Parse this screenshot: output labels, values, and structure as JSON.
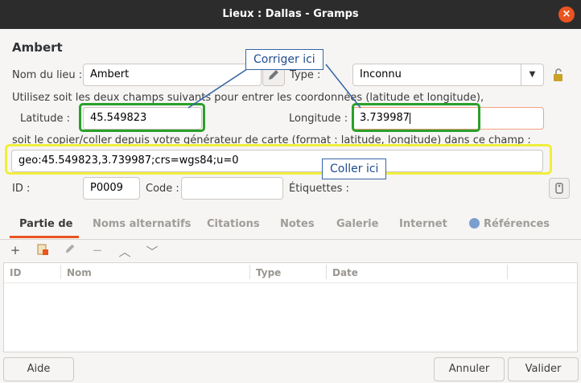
{
  "window": {
    "title": "Lieux : Dallas - Gramps",
    "close": "×"
  },
  "heading": "Ambert",
  "form": {
    "name_label": "Nom du lieu :",
    "name_value": "Ambert",
    "type_label": "Type :",
    "type_value": "Inconnu",
    "hint1": "Utilisez soit les deux champs suivants pour entrer les coordonnées (latitude et longitude),",
    "latitude_label": "Latitude :",
    "latitude_value": "45.549823",
    "longitude_label": "Longitude :",
    "longitude_value": "3.739987",
    "hint2": "soit le copier/coller depuis votre générateur de carte (format : latitude, longitude) dans ce champ :",
    "geo_value": "geo:45.549823,3.739987;crs=wgs84;u=0",
    "id_label": "ID :",
    "id_value": "P0009",
    "code_label": "Code :",
    "code_value": "",
    "tags_label": "Étiquettes :"
  },
  "annotations": {
    "fix_here": "Corriger ici",
    "paste_here": "Coller ici"
  },
  "tabs": [
    {
      "label": "Partie de"
    },
    {
      "label": "Noms alternatifs"
    },
    {
      "label": "Citations"
    },
    {
      "label": "Notes"
    },
    {
      "label": "Galerie"
    },
    {
      "label": "Internet"
    },
    {
      "label": "Références"
    }
  ],
  "table": {
    "columns": [
      "ID",
      "Nom",
      "Type",
      "Date"
    ]
  },
  "buttons": {
    "help": "Aide",
    "cancel": "Annuler",
    "ok": "Valider"
  },
  "colors": {
    "accent": "#e95420",
    "green_highlight": "#2aa02a",
    "yellow_highlight": "#f0ee3c",
    "callout_border": "#3465a4"
  }
}
